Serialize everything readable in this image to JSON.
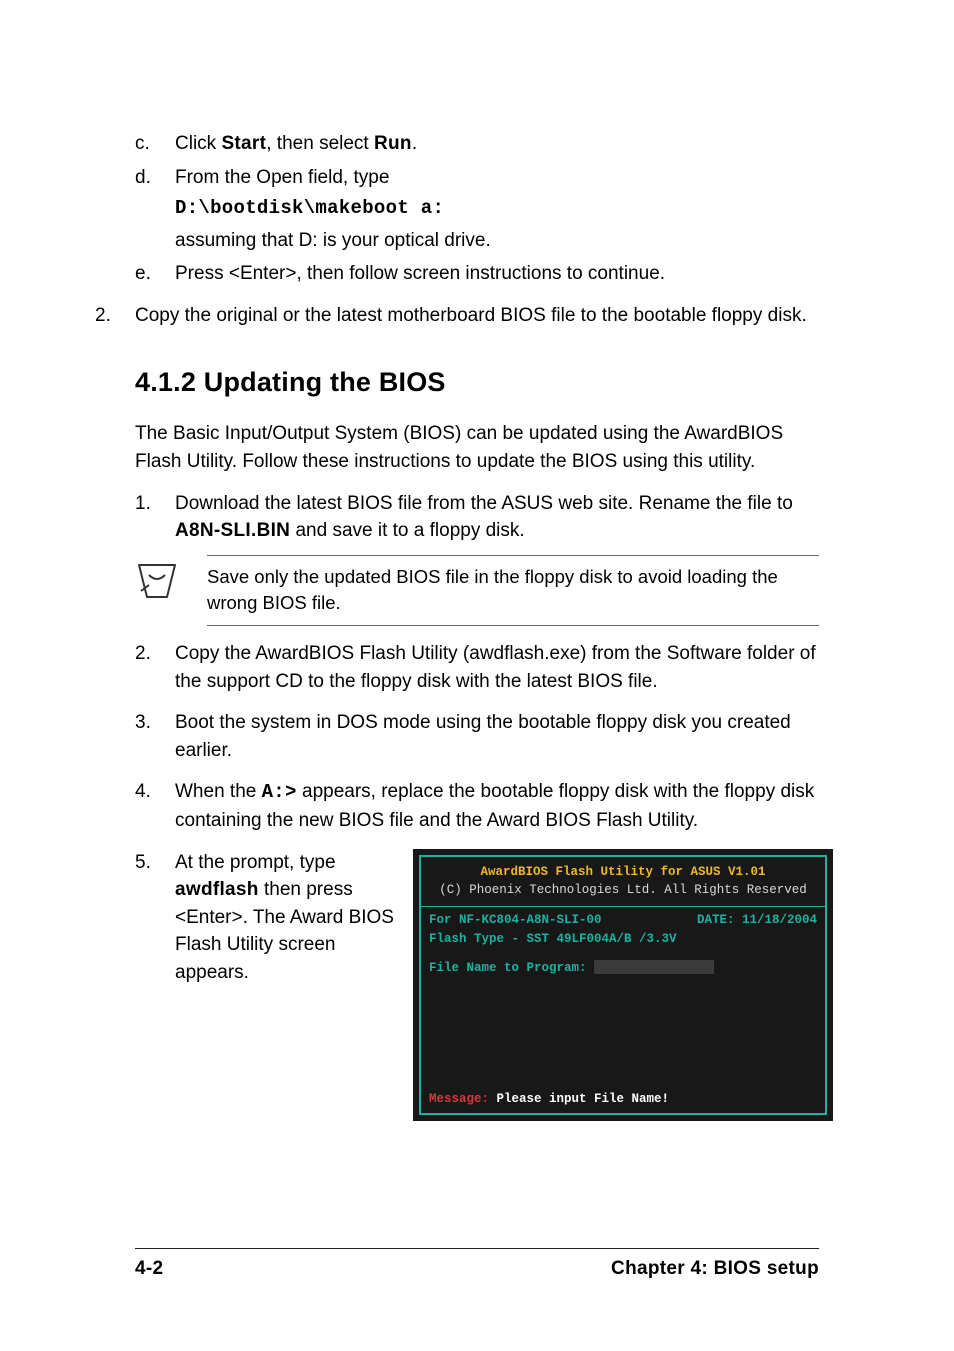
{
  "steps_letters": {
    "c": {
      "marker": "c.",
      "pre": "Click ",
      "bold1": "Start",
      "mid": ", then select ",
      "bold2": "Run",
      "post": "."
    },
    "d": {
      "marker": "d.",
      "text": "From the Open field, type",
      "mono": "D:\\bootdisk\\makeboot a:",
      "assume": "assuming that D: is your optical drive."
    },
    "e": {
      "marker": "e.",
      "text": "Press <Enter>, then follow screen instructions to continue."
    }
  },
  "step2_top": {
    "marker": "2.",
    "text": "Copy the original or the latest motherboard BIOS file to the bootable floppy disk."
  },
  "heading": "4.1.2   Updating the BIOS",
  "intro": "The Basic Input/Output System (BIOS) can be updated using the AwardBIOS Flash Utility. Follow these instructions to update the BIOS using this utility.",
  "numbered": {
    "n1": {
      "marker": "1.",
      "pre": "Download the latest BIOS file from the ASUS web site. Rename the file to ",
      "bold": "A8N-SLI.BIN",
      "post": " and save it to a floppy disk."
    },
    "n2": {
      "marker": "2.",
      "text": "Copy the AwardBIOS Flash Utility (awdflash.exe) from the Software folder of the support CD to the floppy disk with the latest BIOS file."
    },
    "n3": {
      "marker": "3.",
      "text": "Boot the system in DOS mode using the bootable floppy disk you created earlier."
    },
    "n4": {
      "marker": "4.",
      "pre": "When the ",
      "mono": "A:>",
      "post": " appears, replace the bootable floppy disk with the floppy disk containing the new BIOS file and the Award BIOS Flash Utility."
    },
    "n5": {
      "marker": "5.",
      "pre": "At the prompt, type ",
      "bold": "awdflash",
      "post": " then press <Enter>. The Award BIOS Flash Utility screen appears."
    }
  },
  "note": "Save only the updated BIOS file in the floppy disk to avoid loading the wrong BIOS file.",
  "bios": {
    "title": "AwardBIOS Flash Utility for ASUS V1.01",
    "copy": "(C) Phoenix Technologies Ltd. All Rights Reserved",
    "board": "For NF-KC804-A8N-SLI-00",
    "date_label": "DATE:",
    "date": "11/18/2004",
    "flash": "Flash Type - SST 49LF004A/B /3.3V",
    "prompt": "File Name to Program:",
    "msg_label": "Message:",
    "msg_text": "Please input File Name!"
  },
  "footer": {
    "left": "4-2",
    "right": "Chapter 4: BIOS setup"
  }
}
